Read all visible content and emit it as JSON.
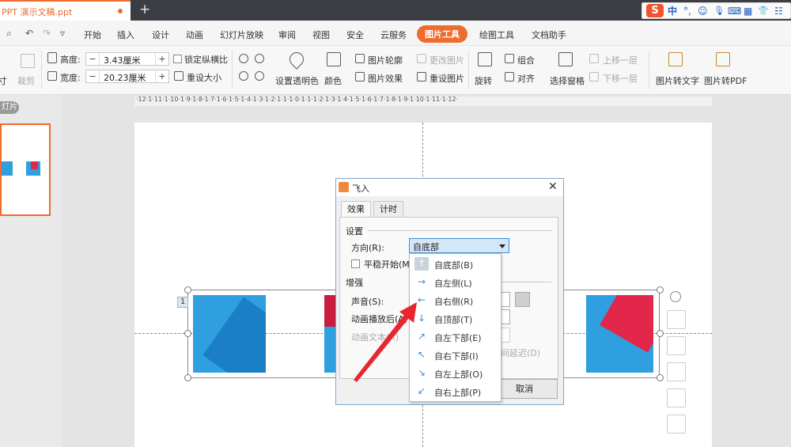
{
  "titlebar": {
    "doc_tab": "PPT 演示文稿.ppt",
    "new_tab": "+",
    "ime": {
      "logo": "S",
      "lang": "中",
      "punct": "°,",
      "emoji": "☺",
      "mic": "🎙",
      "keyboard": "⌨",
      "grid": "▦",
      "shirt": "👕",
      "menu": "☷"
    }
  },
  "menubar": {
    "quick": [
      "⌕",
      "↶",
      "↷",
      "▿"
    ],
    "items": [
      "开始",
      "插入",
      "设计",
      "动画",
      "幻灯片放映",
      "审阅",
      "视图",
      "安全",
      "云服务",
      "图片工具",
      "绘图工具",
      "文档助手"
    ],
    "active": "图片工具"
  },
  "ribbon": {
    "crop": "裁剪",
    "height_label": "高度:",
    "height_value": "3.43厘米",
    "width_label": "宽度:",
    "width_value": "20.23厘米",
    "lock_ratio": "锁定纵横比",
    "reset_size": "重设大小",
    "set_transparent": "设置透明色",
    "color": "颜色",
    "picture_outline": "图片轮廓",
    "picture_effect": "图片效果",
    "change_picture": "更改图片",
    "reset_picture": "重设图片",
    "rotate": "旋转",
    "group": "组合",
    "align": "对齐",
    "selection_pane": "选择窗格",
    "bring_forward": "上移一层",
    "send_backward": "下移一层",
    "pic_to_text": "图片转文字",
    "pic_to_pdf": "图片转PDF",
    "minus": "−",
    "plus": "+",
    "left_edge": "寸"
  },
  "panel": {
    "slides_badge": "灯片",
    "ruler": "·12·1·11·1·10·1·9·1·8·1·7·1·6·1·5·1·4·1·3·1·2·1·1·1·0·1·1·1·2·1·3·1·4·1·5·1·6·1·7·1·8·1·9·1·10·1·11·1·12·"
  },
  "slide": {
    "anim_badge": "1"
  },
  "dialog": {
    "title": "飞入",
    "close": "✕",
    "tabs": [
      "效果",
      "计时"
    ],
    "settings": "设置",
    "direction_label": "方向(R):",
    "direction_value": "自底部",
    "smooth_start": "平稳开始(M)",
    "enhance": "增强",
    "sound": "声音(S):",
    "after_anim": "动画播放后(A)",
    "anim_text": "动画文本(X)",
    "delay": "间延迟(D)",
    "cancel": "取消"
  },
  "dropdown": [
    {
      "icon": "↑",
      "label": "自底部(B)"
    },
    {
      "icon": "→",
      "label": "自左侧(L)"
    },
    {
      "icon": "←",
      "label": "自右侧(R)"
    },
    {
      "icon": "↓",
      "label": "自顶部(T)"
    },
    {
      "icon": "↗",
      "label": "自左下部(E)"
    },
    {
      "icon": "↖",
      "label": "自右下部(I)"
    },
    {
      "icon": "↘",
      "label": "自左上部(O)"
    },
    {
      "icon": "↙",
      "label": "自右上部(P)"
    }
  ],
  "colors": {
    "accent": "#ef6b2e",
    "arrow": "#e8262d",
    "selection": "#d4e7f8"
  }
}
